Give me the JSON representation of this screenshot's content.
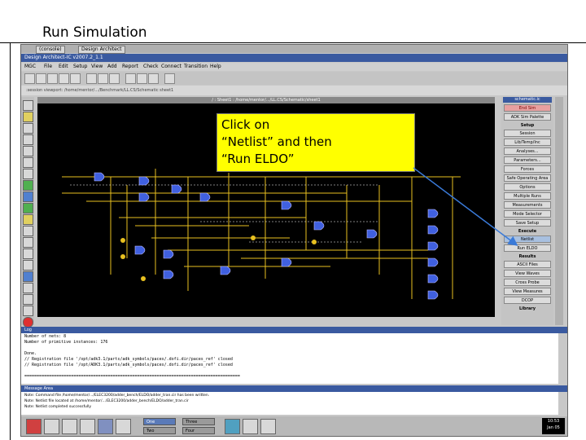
{
  "slide": {
    "title": "Run Simulation",
    "callout_line1": "Click on",
    "callout_line2": "“Netlist” and then",
    "callout_line3": "“Run ELDO”"
  },
  "taskbar_top": {
    "tabs": [
      "(console)",
      "Design Architect"
    ]
  },
  "window": {
    "title": "Design Architect-IC v2007.2_1.1"
  },
  "menu": [
    "MGC",
    "File",
    "Edit",
    "Setup",
    "View",
    "Add",
    "Report",
    "Check",
    "Connect",
    "Transition",
    "Help"
  ],
  "path": ":session viewport: /home/mentor/.../Benchmark/LL.CS/Schematic sheet1",
  "canvas": {
    "title": "/ : Sheet1 : /home/mentor/.../LL.CS/Schematic/sheet1"
  },
  "right_panel": {
    "header": "schematic.ic",
    "items": [
      {
        "type": "btn-red",
        "label": "End Sim"
      },
      {
        "type": "btn",
        "label": "ADK Sim Palette"
      },
      {
        "type": "sec",
        "label": "Setup"
      },
      {
        "type": "btn",
        "label": "Session"
      },
      {
        "type": "btn",
        "label": "Lib/Temp/Inc"
      },
      {
        "type": "btn",
        "label": "Analyses..."
      },
      {
        "type": "btn",
        "label": "Parameters..."
      },
      {
        "type": "btn",
        "label": "Forces"
      },
      {
        "type": "btn",
        "label": "Safe Operating Area"
      },
      {
        "type": "btn",
        "label": "Options"
      },
      {
        "type": "btn",
        "label": "Multiple Runs"
      },
      {
        "type": "btn",
        "label": "Measurements"
      },
      {
        "type": "btn",
        "label": "Mode Selector"
      },
      {
        "type": "btn",
        "label": "Save Setup"
      },
      {
        "type": "sec",
        "label": "Execute"
      },
      {
        "type": "btn-sel",
        "label": "Netlist"
      },
      {
        "type": "btn",
        "label": "Run ELDO"
      },
      {
        "type": "sec",
        "label": "Results"
      },
      {
        "type": "btn",
        "label": "ASCII Files"
      },
      {
        "type": "btn",
        "label": "View Waves"
      },
      {
        "type": "btn",
        "label": "Cross Probe"
      },
      {
        "type": "btn",
        "label": "View Measures"
      },
      {
        "type": "btn",
        "label": "DCOP"
      },
      {
        "type": "sec",
        "label": "Library"
      }
    ]
  },
  "log": {
    "title": "Log",
    "lines": [
      "Number of nets: 8",
      "Number of primitive instances: 176",
      "",
      "Done.",
      "// Registration file '/opt/adk3.1/parts/adk_symbols/paces/.dofi.dir/paces_ref' closed",
      "// Registration file '/opt/ADK3.1/parts/adk_symbols/paces/.dofi.dir/paces_ref' closed",
      "",
      "========================================================================================"
    ]
  },
  "messages": {
    "title": "Message Area",
    "lines": [
      "Note: Command file /home/mentor/.../ELEC3200/adder_bench/ELDO/adder_tran.cir has been written.",
      "Note: Netlist file located at /home/mentor/.../ELEC3200/adder_bench/ELDO/adder_tran.cir",
      "Note: Netlist completed successfully"
    ]
  },
  "taskbar_bottom": {
    "workspaces": [
      "One",
      "Two",
      "Three",
      "Four"
    ],
    "clock_time": "10:53",
    "clock_date": "Jan 05"
  },
  "colors": {
    "callout": "#ffff00",
    "arrow": "#3a7ad8",
    "titlebar": "#3a5aa0"
  }
}
